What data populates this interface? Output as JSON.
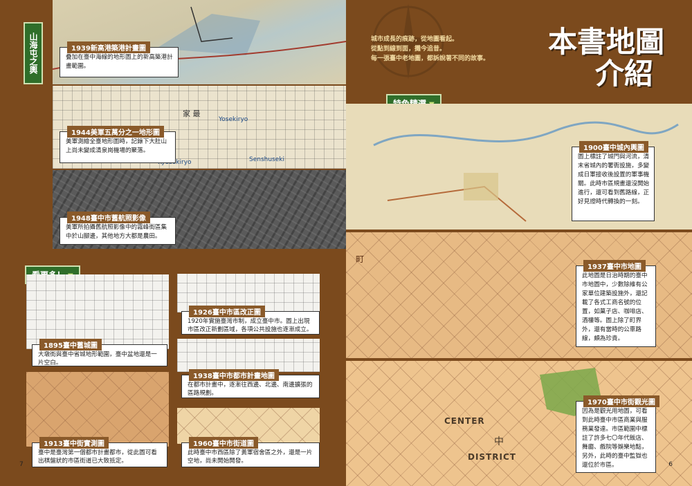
{
  "left_page": {
    "vertical_tag": "山海屯之輿",
    "see_more_tag": "看更多！",
    "page_number": "7",
    "top_maps": [
      {
        "title": "1939新高港築港計畫圖",
        "text": "疊加在臺中海線的地形圖上的新高築港計畫範圍。"
      },
      {
        "title": "1944美軍五萬分之一地形圖",
        "text": "美軍測繪全臺地形圖時，記錄下大肚山上尚未變成清泉崗機場的聚落。"
      },
      {
        "title": "1948臺中市舊航照影像",
        "text": "美軍所拍攝舊航照影像中的霧峰街區集中於山腳邊，其他地方大都是農田。"
      }
    ],
    "map_labels": [
      "Yosekiryo",
      "Kyosekiryo",
      "Senshuseki",
      "家 最"
    ],
    "bottom_maps": [
      {
        "title": "1895臺中舊城圖",
        "text": "大墩街與臺中省城地形範圍，臺中盆地還是一片空白。"
      },
      {
        "title": "1926臺中市區改正圖",
        "text": "1920年實施臺灣市制，成立臺中市。圖上出現市區改正新劃區域，各項公共設施也逐漸成立。"
      },
      {
        "title": "1938臺中市都市計畫地圖",
        "text": "在都市計畫中，逐漸往西邊、北邊、南邊擴張的區路規劃。"
      },
      {
        "title": "1913臺中街實測圖",
        "text": "臺中是臺灣第一個都市計畫都市，從此圖可看出棋盤狀的市區街道已大致抵定。"
      },
      {
        "title": "1960臺中市街道圖",
        "text": "此時臺中市西區除了黃軍宿舍區之外，還是一片空地，尚未開始開發。"
      }
    ]
  },
  "right_page": {
    "title_line1": "本書地圖",
    "title_line2": "介紹",
    "intro": [
      "城市成長的痕跡，從地圖看起。",
      "從點到線到面，攤今追昔。",
      "每一張臺中老地圖，都訴說著不同的故事。"
    ],
    "feature_tag": "特色精選",
    "page_number": "6",
    "map_labels": [
      "CENTER",
      "DISTRICT",
      "中",
      "町"
    ],
    "maps": [
      {
        "title": "1900臺中城內輿圖",
        "text": "圖上標註了城門與河流，清末省城內的署衙設施，多變成日軍接收後設置的軍事機關。此時市區規畫還沒開始進行，還可看到舊路線，正好見證時代轉換的一刻。"
      },
      {
        "title": "1937臺中市地圖",
        "text": "此地圖是日治時期的臺中市地圖中，少數除維有公家單位建築設施外，還記載了各式工商名號的位置，如菓子店、咖啡店、酒樓等。圖上除了町界外，還有當時的公車路線，頗為珍貴。"
      },
      {
        "title": "1970臺中市街觀光圖",
        "text": "因為是觀光用地圖，可看到此時臺中市區商業與服務業發達。市區範圍中標註了許多七〇年代飯店、舞廳、戲院等娛樂地點，另外，此時的臺中監獄也還位於市區。"
      }
    ]
  }
}
